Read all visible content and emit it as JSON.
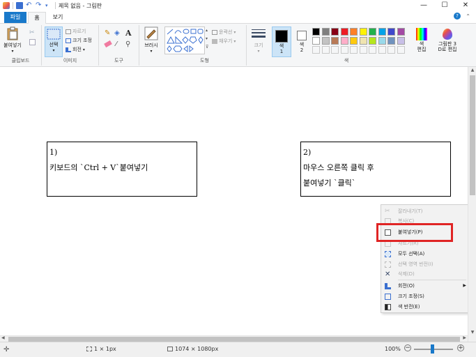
{
  "window": {
    "title": "제목 없음 - 그림판",
    "controls": {
      "minimize": "—",
      "maximize": "☐",
      "close": "✕"
    }
  },
  "tabs": {
    "file": "파일",
    "home": "홈",
    "view": "보기"
  },
  "ribbon": {
    "clipboard": {
      "paste": "붙여넣기",
      "label": "클립보드"
    },
    "image": {
      "select": "선택",
      "crop": "자르기",
      "resize": "크기 조정",
      "rotate": "회전",
      "label": "이미지"
    },
    "tools": {
      "label": "도구",
      "text_glyph": "A"
    },
    "brushes": {
      "label": "브러시"
    },
    "shapes": {
      "outline": "윤곽선",
      "fill": "채우기",
      "label": "도형"
    },
    "size": {
      "label": "크기"
    },
    "colors": {
      "color1": "색\n1",
      "color2": "색\n2",
      "edit": "색\n편집",
      "paint3d": "그림판 3\nD로 편집",
      "label": "색",
      "palette_row1": [
        "#000000",
        "#7f7f7f",
        "#880015",
        "#ed1c24",
        "#ff7f27",
        "#fff200",
        "#22b14c",
        "#00a2e8",
        "#3f48cc",
        "#a349a4"
      ],
      "palette_row2": [
        "#ffffff",
        "#c3c3c3",
        "#b97a57",
        "#ffaec9",
        "#ffc90e",
        "#efe4b0",
        "#b5e61d",
        "#99d9ea",
        "#7092be",
        "#c8bfe7"
      ]
    }
  },
  "notes": {
    "left": {
      "line1": "1)",
      "line2": "키보드의 `Ctrl + V`붙여넣기"
    },
    "right": {
      "line1": "2)",
      "line2": "마우스 오른쪽 클릭 후",
      "line3": "붙여넣기 `클릭`"
    }
  },
  "context_menu": {
    "items": [
      {
        "label": "잘라내기(T)",
        "disabled": true
      },
      {
        "label": "복사(C)",
        "disabled": true
      },
      {
        "label": "붙여넣기(P)",
        "disabled": false
      },
      {
        "label": "자르기(R)",
        "disabled": true
      },
      {
        "label": "모두 선택(A)",
        "disabled": false
      },
      {
        "label": "선택 영역 반전(I)",
        "disabled": true
      },
      {
        "label": "삭제(D)",
        "disabled": true
      },
      {
        "label": "회전(O)",
        "disabled": false
      },
      {
        "label": "크기 조정(S)",
        "disabled": false
      },
      {
        "label": "색 반전(E)",
        "disabled": false
      }
    ]
  },
  "statusbar": {
    "position": "",
    "selection_size": "1 × 1px",
    "image_size": "1074 × 1080px",
    "zoom": "100%"
  }
}
